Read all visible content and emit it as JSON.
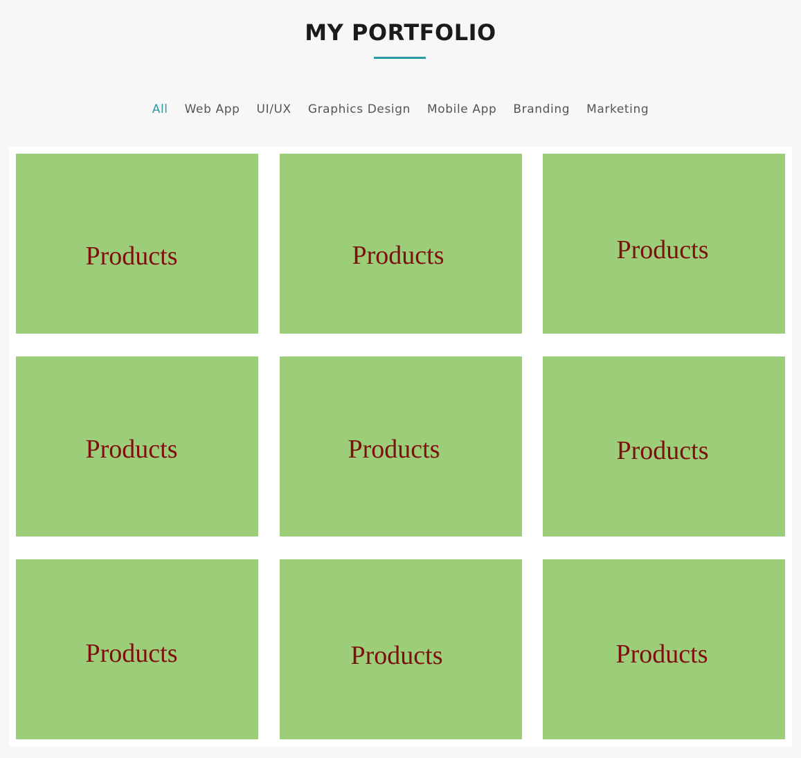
{
  "header": {
    "title": "MY PORTFOLIO"
  },
  "filters": [
    {
      "label": "All",
      "active": true
    },
    {
      "label": "Web App",
      "active": false
    },
    {
      "label": "UI/UX",
      "active": false
    },
    {
      "label": "Graphics Design",
      "active": false
    },
    {
      "label": "Mobile App",
      "active": false
    },
    {
      "label": "Branding",
      "active": false
    },
    {
      "label": "Marketing",
      "active": false
    }
  ],
  "portfolio": {
    "items": [
      {
        "label": "Products"
      },
      {
        "label": "Products"
      },
      {
        "label": "Products"
      },
      {
        "label": "Products"
      },
      {
        "label": "Products"
      },
      {
        "label": "Products"
      },
      {
        "label": "Products"
      },
      {
        "label": "Products"
      },
      {
        "label": "Products"
      }
    ]
  },
  "colors": {
    "accent": "#2a9aa3",
    "card_background": "#9ccd78",
    "card_text": "#7e0f0f",
    "page_background": "#f7f7f7",
    "grid_background": "#ffffff"
  }
}
